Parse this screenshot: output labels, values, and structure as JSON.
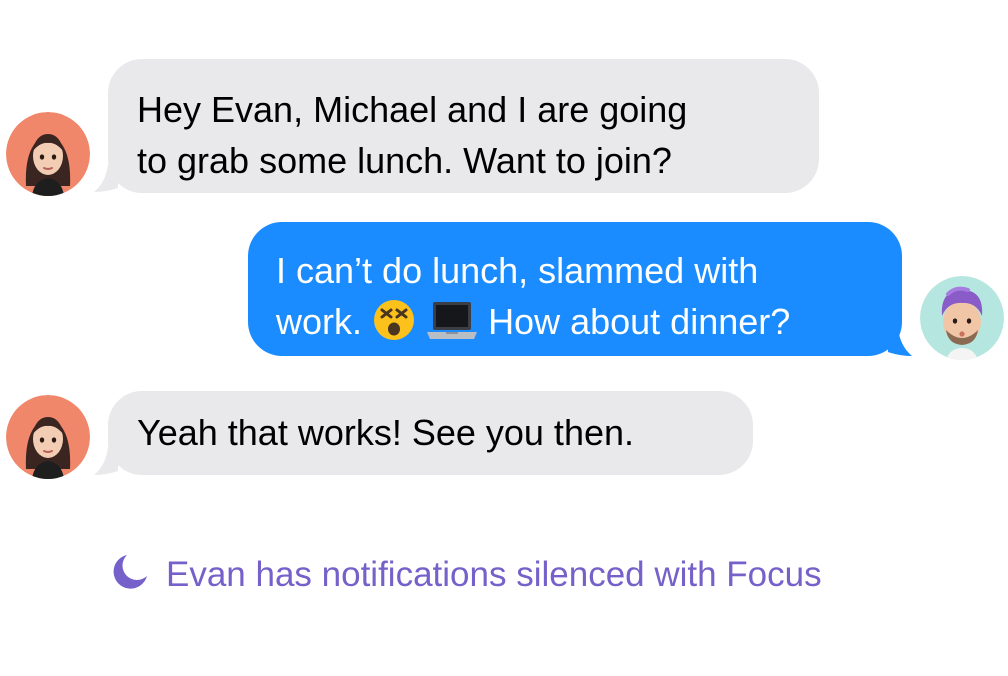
{
  "conversation": {
    "messages": [
      {
        "sender": "incoming",
        "lines": [
          "Hey Evan, Michael and I are going",
          "to grab some lunch. Want to join?"
        ]
      },
      {
        "sender": "outgoing",
        "line1": "I can’t do lunch, slammed with",
        "line2_start": "work.",
        "emoji_face": "dizzy-face-emoji",
        "emoji_laptop": "laptop-emoji",
        "line2_end": "How about dinner?"
      },
      {
        "sender": "incoming",
        "lines": [
          "Yeah that works! See you then."
        ]
      }
    ]
  },
  "focus_notice": {
    "icon": "moon-icon",
    "text": "Evan has notifications silenced with Focus"
  },
  "colors": {
    "incoming_bubble": "#e9e9eb",
    "outgoing_bubble": "#1a8cff",
    "focus_text": "#7660c9",
    "avatar_female_bg": "#f0866a",
    "avatar_male_bg": "#b6e6e0"
  }
}
